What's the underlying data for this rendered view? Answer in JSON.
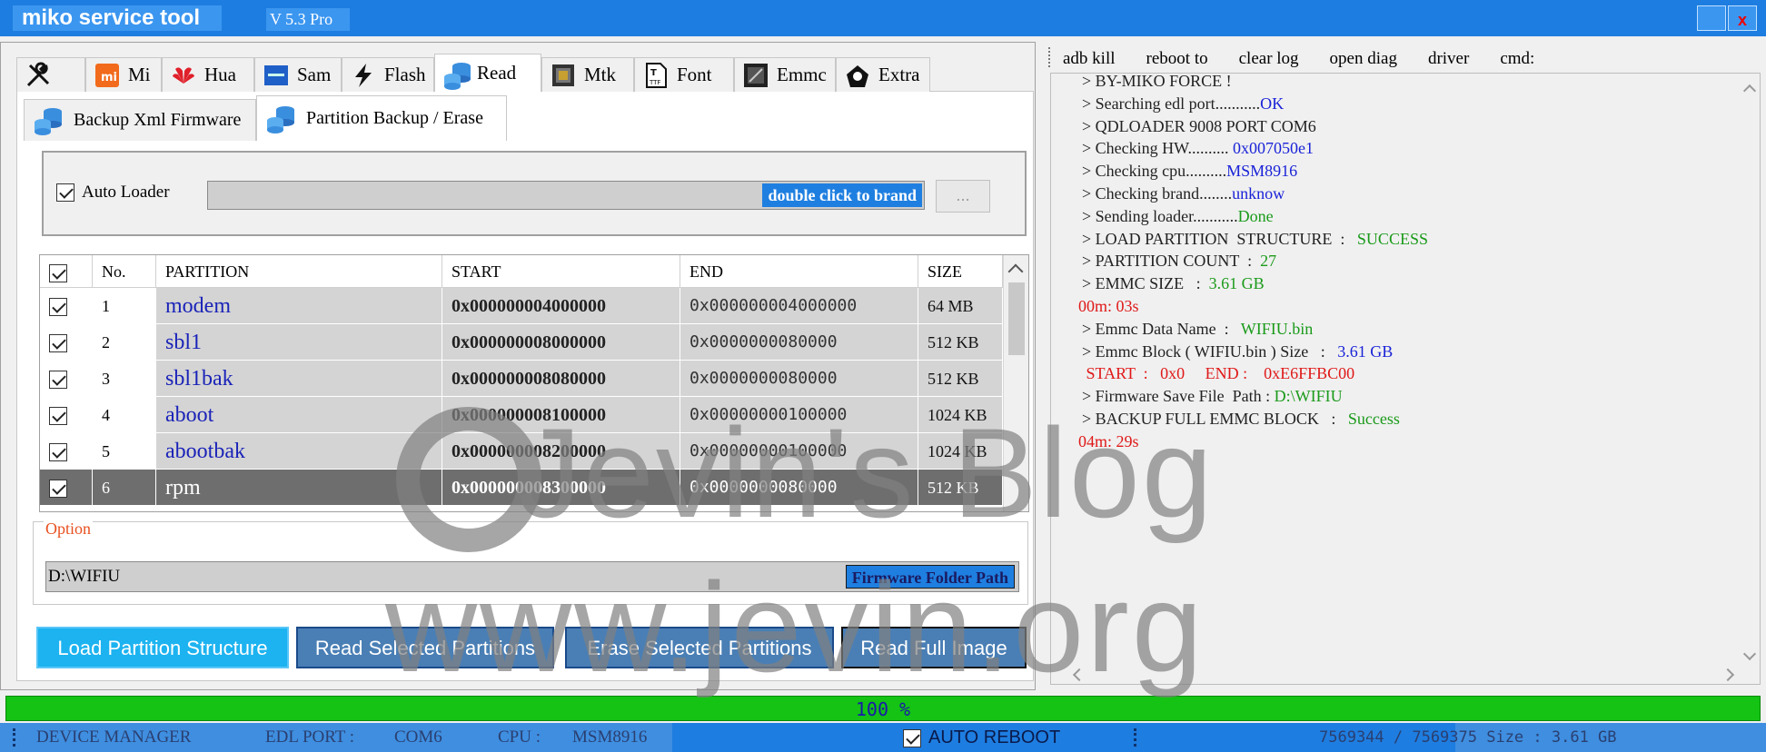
{
  "window": {
    "title": "miko service tool",
    "version": "V 5.3 Pro",
    "close_glyph": "x"
  },
  "tabs": [
    {
      "label": "",
      "icon": "tools-icon"
    },
    {
      "label": "Mi",
      "icon": "mi-icon"
    },
    {
      "label": "Hua",
      "icon": "huawei-icon"
    },
    {
      "label": "Sam",
      "icon": "samsung-icon"
    },
    {
      "label": "Flash",
      "icon": "flash-icon"
    },
    {
      "label": "Read",
      "icon": "database-icon",
      "active": true
    },
    {
      "label": "Mtk",
      "icon": "chip-icon"
    },
    {
      "label": "Font",
      "icon": "font-file-icon"
    },
    {
      "label": "Emmc",
      "icon": "emmc-icon"
    },
    {
      "label": "Extra",
      "icon": "extra-icon"
    }
  ],
  "subtabs": [
    {
      "label": "Backup Xml Firmware"
    },
    {
      "label": "Partition Backup / Erase",
      "active": true
    }
  ],
  "loader": {
    "auto_loader_label": "Auto Loader",
    "brand_button": "double click to brand",
    "browse_button": "..."
  },
  "table": {
    "headers": [
      "No.",
      "PARTITION",
      "START",
      "END",
      "SIZE"
    ],
    "rows": [
      {
        "no": "1",
        "partition": "modem",
        "start": "0x000000004000000",
        "end": "0x000000004000000",
        "size": "64 MB"
      },
      {
        "no": "2",
        "partition": "sbl1",
        "start": "0x000000008000000",
        "end": "0x0000000080000",
        "size": "512 KB"
      },
      {
        "no": "3",
        "partition": "sbl1bak",
        "start": "0x000000008080000",
        "end": "0x0000000080000",
        "size": "512 KB"
      },
      {
        "no": "4",
        "partition": "aboot",
        "start": "0x000000008100000",
        "end": "0x00000000100000",
        "size": "1024 KB"
      },
      {
        "no": "5",
        "partition": "abootbak",
        "start": "0x000000008200000",
        "end": "0x00000000100000",
        "size": "1024 KB"
      },
      {
        "no": "6",
        "partition": "rpm",
        "start": "0x000000008300000",
        "end": "0x0000000080000",
        "size": "512 KB",
        "selected": true
      }
    ]
  },
  "option": {
    "label": "Option",
    "path": "D:\\WIFIU",
    "path_button": "Firmware Folder Path"
  },
  "actions": {
    "load": "Load Partition Structure",
    "read": "Read Selected Partitions",
    "erase": "Erase Selected Partitions",
    "full": "Read Full Image"
  },
  "right_toolbar": [
    "adb kill",
    "reboot to",
    "clear log",
    "open diag",
    "driver",
    "cmd:"
  ],
  "log": [
    {
      "segs": [
        {
          "t": "> BY-MIKO FORCE !",
          "c": "#222"
        }
      ]
    },
    {
      "segs": [
        {
          "t": "> Searching edl port...........",
          "c": "#222"
        },
        {
          "t": "OK",
          "c": "#1a23d8"
        }
      ]
    },
    {
      "segs": [
        {
          "t": "> QDLOADER 9008 PORT COM6",
          "c": "#222"
        }
      ]
    },
    {
      "segs": [
        {
          "t": "> Checking HW.......... ",
          "c": "#222"
        },
        {
          "t": "0x007050e1",
          "c": "#1a23d8"
        }
      ]
    },
    {
      "segs": [
        {
          "t": "> Checking cpu..........",
          "c": "#222"
        },
        {
          "t": "MSM8916",
          "c": "#1a23d8"
        }
      ]
    },
    {
      "segs": [
        {
          "t": "> Checking brand........",
          "c": "#222"
        },
        {
          "t": "unknow",
          "c": "#1a23d8"
        }
      ]
    },
    {
      "segs": [
        {
          "t": "> Sending loader...........",
          "c": "#222"
        },
        {
          "t": "Done",
          "c": "#1a9a1a"
        }
      ]
    },
    {
      "segs": [
        {
          "t": "> LOAD PARTITION  STRUCTURE  :   ",
          "c": "#222"
        },
        {
          "t": "SUCCESS",
          "c": "#1a9a1a"
        }
      ]
    },
    {
      "segs": [
        {
          "t": "> PARTITION COUNT  :  ",
          "c": "#222"
        },
        {
          "t": "27",
          "c": "#1a9a1a"
        }
      ]
    },
    {
      "segs": [
        {
          "t": "> EMMC SIZE   :  ",
          "c": "#222"
        },
        {
          "t": "3.61 GB",
          "c": "#1a9a1a"
        }
      ]
    },
    {
      "segs": [
        {
          "t": "00m: 03s",
          "c": "#e01818"
        }
      ],
      "nx": true
    },
    {
      "segs": [
        {
          "t": "> Emmc Data Name  :   ",
          "c": "#222"
        },
        {
          "t": "WIFIU.bin",
          "c": "#1a9a1a"
        }
      ]
    },
    {
      "segs": [
        {
          "t": "> Emmc Block ( WIFIU.bin ) Size   :   ",
          "c": "#222"
        },
        {
          "t": "3.61 GB",
          "c": "#1a23d8"
        }
      ]
    },
    {
      "segs": [
        {
          "t": " START  :   0x0     END :    0xE6FFBC00",
          "c": "#e01818"
        }
      ]
    },
    {
      "segs": [
        {
          "t": "> Firmware Save File  Path : ",
          "c": "#222"
        },
        {
          "t": "D:\\WIFIU",
          "c": "#1a9a1a"
        }
      ]
    },
    {
      "segs": [
        {
          "t": "> BACKUP FULL EMMC BLOCK   :   ",
          "c": "#222"
        },
        {
          "t": "Success",
          "c": "#1a9a1a"
        }
      ]
    },
    {
      "segs": [
        {
          "t": "04m: 29s",
          "c": "#e01818"
        }
      ],
      "nx": true
    }
  ],
  "progress": {
    "percent": 100,
    "label": "100 %"
  },
  "status": {
    "device_manager": "DEVICE MANAGER",
    "edl_port_label": "EDL PORT :",
    "edl_port_value": "COM6",
    "cpu_label": "CPU :",
    "cpu_value": "MSM8916",
    "auto_reboot": "AUTO REBOOT",
    "blocks": "7569344  /  7569375  Size : 3.61 GB"
  },
  "watermark": {
    "line1": "Jevin's Blog",
    "line2": "www.jevin.org"
  }
}
